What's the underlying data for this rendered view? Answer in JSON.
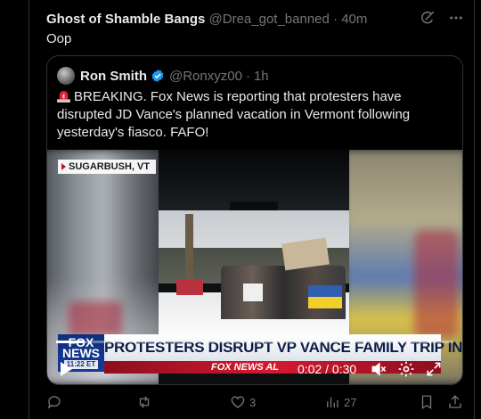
{
  "tweet": {
    "author_name": "Ghost of Shamble Bangs",
    "handle": "@Drea_got_banned",
    "separator": "·",
    "time": "40m",
    "text": "Oop"
  },
  "quote": {
    "author_name": "Ron Smith",
    "handle": "@Ronxyz00",
    "separator": "·",
    "time": "1h",
    "text": "BREAKING. Fox News is reporting that protesters have disrupted JD Vance's planned vacation in Vermont following yesterday's fiasco. FAFO!",
    "video": {
      "location_tag": "SUGARBUSH, VT",
      "fox_logo_line1": "FOX",
      "fox_logo_line2": "NEWS",
      "fox_logo_time": "11:22 ET",
      "headline": "PROTESTERS DISRUPT VP VANCE FAMILY TRIP IN VT",
      "ticker": "FOX NEWS AL",
      "timecode": "0:02 / 0:30",
      "progress_fraction": 0.07
    }
  },
  "actions": {
    "replies": "",
    "reposts": "",
    "likes": "3",
    "views": "27"
  },
  "colors": {
    "background": "#000000",
    "text_primary": "#e7e9ea",
    "text_secondary": "#71767b",
    "border": "#2f3336",
    "verified": "#1d9bf0",
    "fox_blue": "#0f2f7d",
    "fox_red": "#d6182f"
  },
  "icons": [
    "grok-icon",
    "more-icon",
    "verified-icon",
    "siren-icon",
    "play-icon",
    "mute-icon",
    "settings-icon",
    "fullscreen-icon",
    "reply-icon",
    "repost-icon",
    "like-icon",
    "views-icon",
    "bookmark-icon",
    "share-icon"
  ]
}
